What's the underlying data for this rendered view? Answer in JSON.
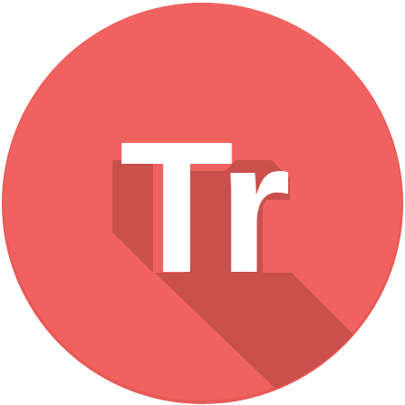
{
  "app_icon": {
    "monogram": "Tr",
    "icon": "app-icon",
    "colors": {
      "background_circle": "#F0625F",
      "edge_shade": "#E85956",
      "long_shadow": "#C9504C",
      "letters": "#FFFFFF"
    }
  }
}
